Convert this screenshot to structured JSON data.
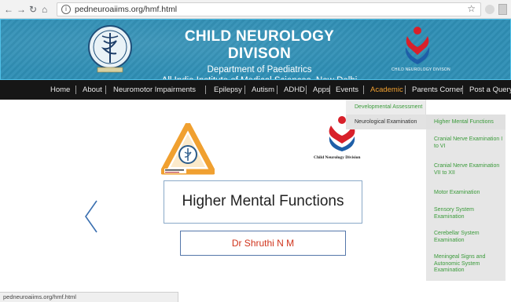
{
  "browser": {
    "url": "pedneuroaiims.org/hmf.html",
    "status_url": "pedneuroaiims.org/hmf.html",
    "nav_icons": [
      "back-arrow-icon",
      "forward-arrow-icon",
      "reload-icon",
      "home-icon"
    ]
  },
  "header": {
    "title": "CHILD NEUROLOGY DIVISON",
    "subtitle1": "Department of Paediatrics",
    "subtitle2": "All India Institute of Medical Sciences, New Delhi",
    "logo_caption": "CHILD NEUROLOGY DIVISON",
    "bg_color": "#2f8fb5"
  },
  "nav": {
    "items": [
      {
        "label": "Home"
      },
      {
        "label": "About"
      },
      {
        "label": "Neuromotor Impairments"
      },
      {
        "label": "Epilepsy"
      },
      {
        "label": "Autism"
      },
      {
        "label": "ADHD"
      },
      {
        "label": "Apps"
      },
      {
        "label": "Events"
      },
      {
        "label": "Academic"
      },
      {
        "label": "Parents Corner"
      },
      {
        "label": "Post a Query"
      }
    ],
    "active": "Academic",
    "active_color": "#f0a030"
  },
  "academic_menu": {
    "items": [
      {
        "label": "Developmental Assessment"
      },
      {
        "label": "Neurological Examination"
      }
    ]
  },
  "exam_submenu": {
    "items": [
      {
        "label": "Higher Mental Functions"
      },
      {
        "label": "Cranial Nerve Examination I to VI"
      },
      {
        "label": "Cranial Nerve Examination VII to XII"
      },
      {
        "label": "Motor Examination"
      },
      {
        "label": "Sensory System Examination"
      },
      {
        "label": "Cerebellar System Examination"
      },
      {
        "label": "Meningeal Signs and Autonomic System Examination"
      }
    ],
    "link_color": "#3a9a3a"
  },
  "slide": {
    "title": "Higher Mental Functions",
    "author": "Dr Shruthi N M",
    "logo_caption": "Child Neurology Division",
    "author_color": "#d0341c"
  }
}
